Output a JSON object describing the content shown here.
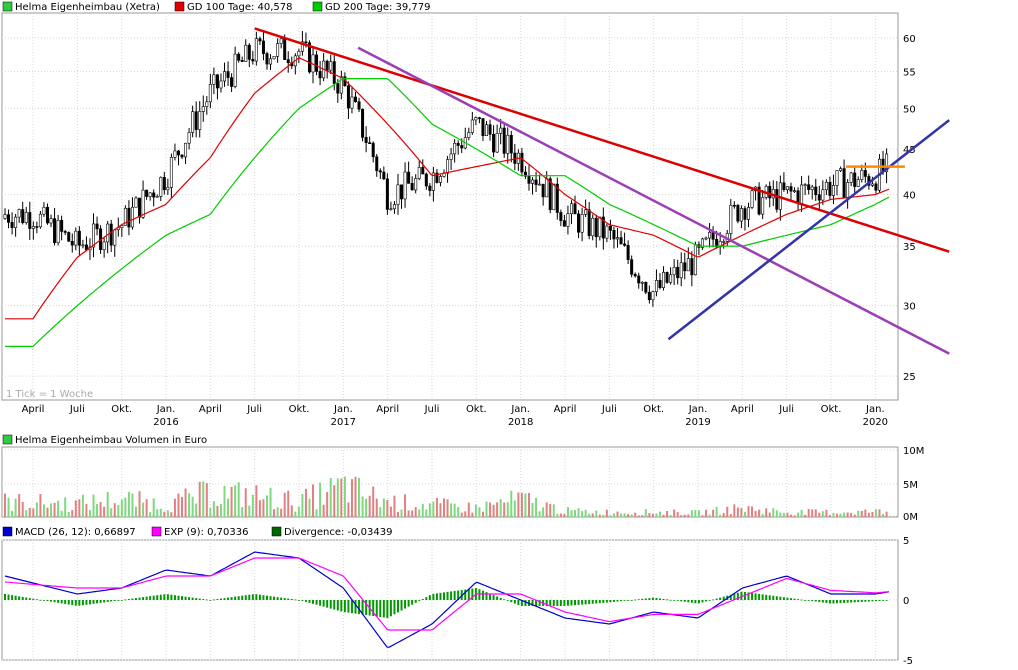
{
  "legend_main": {
    "stock": "Helma Eigenheimbau (Xetra)",
    "gd100": "GD 100 Tage: 40,578",
    "gd200": "GD 200 Tage: 39,779",
    "colors": {
      "stock": "#2ecc40",
      "gd100": "#e00000",
      "gd200": "#00cc00"
    }
  },
  "tick_note": "1 Tick = 1 Woche",
  "legend_volume": {
    "label": "Helma Eigenheimbau Volumen in Euro",
    "color": "#2ecc40"
  },
  "legend_macd": {
    "macd": "MACD (26, 12): 0,66897",
    "exp": "EXP (9): 0,70336",
    "divergence": "Divergence: -0,03439",
    "colors": {
      "macd": "#0000cc",
      "exp": "#ff00ff",
      "divergence": "#006600"
    }
  },
  "x_months": [
    "April",
    "Juli",
    "Okt.",
    "Jan.",
    "April",
    "Juli",
    "Okt.",
    "Jan.",
    "April",
    "Juli",
    "Okt.",
    "Jan.",
    "April",
    "Juli",
    "Okt.",
    "Jan.",
    "April",
    "Juli",
    "Okt.",
    "Jan."
  ],
  "x_years": [
    "2016",
    "2017",
    "2018",
    "2019",
    "2020"
  ],
  "y_price_ticks": [
    "60",
    "55",
    "50",
    "45",
    "40",
    "35",
    "30",
    "25"
  ],
  "y_volume_ticks": [
    "10M",
    "5M",
    "0M"
  ],
  "y_macd_ticks": [
    "5",
    "0",
    "-5"
  ],
  "chart_data": [
    {
      "type": "line",
      "title": "Helma Eigenheimbau (Xetra)",
      "scale": "log",
      "ylim": [
        23.5,
        64
      ],
      "x": [
        "2015-04",
        "2015-07",
        "2015-10",
        "2016-01",
        "2016-04",
        "2016-07",
        "2016-10",
        "2017-01",
        "2017-04",
        "2017-07",
        "2017-10",
        "2018-01",
        "2018-04",
        "2018-07",
        "2018-10",
        "2019-01",
        "2019-04",
        "2019-07",
        "2019-10",
        "2020-01",
        "2020-02"
      ],
      "series": [
        {
          "name": "Helma Eigenheimbau (Xetra)",
          "values": [
            38,
            35,
            37,
            42,
            52,
            58,
            58,
            53,
            40,
            42,
            48,
            44,
            38,
            36,
            31,
            34,
            39,
            40,
            41,
            42,
            43
          ]
        },
        {
          "name": "GD 100 Tage: 40,578",
          "values": [
            29,
            34,
            37,
            39,
            44,
            52,
            57,
            54,
            48,
            42,
            43,
            44,
            40,
            37,
            36,
            34,
            36,
            38,
            39.5,
            40,
            40.6
          ]
        },
        {
          "name": "GD 200 Tage: 39,779",
          "values": [
            27,
            30,
            33,
            36,
            38,
            44,
            50,
            54,
            54,
            48,
            45,
            42,
            42,
            39,
            37,
            35,
            35,
            36,
            37,
            39,
            39.8
          ]
        }
      ],
      "trendlines": [
        {
          "color": "#dd0000",
          "from": [
            "2016-07",
            61.5
          ],
          "to": [
            "2020-06",
            34.5
          ]
        },
        {
          "color": "#9b3fb5",
          "from": [
            "2017-02",
            58.5
          ],
          "to": [
            "2020-06",
            26.5
          ]
        },
        {
          "color": "#3333aa",
          "from": [
            "2018-11",
            27.5
          ],
          "to": [
            "2020-06",
            48.5
          ]
        },
        {
          "color": "#ff8800",
          "from": [
            "2019-11",
            43
          ],
          "to": [
            "2020-03",
            43
          ]
        }
      ]
    },
    {
      "type": "bar",
      "title": "Helma Eigenheimbau Volumen in Euro",
      "ylim": [
        0,
        10000000
      ],
      "x": [
        "2015-Q2",
        "2015-Q3",
        "2015-Q4",
        "2016-Q1",
        "2016-Q2",
        "2016-Q3",
        "2016-Q4",
        "2017-Q1",
        "2017-Q2",
        "2017-Q3",
        "2017-Q4",
        "2018-Q1",
        "2018-Q2",
        "2018-Q3",
        "2018-Q4",
        "2019-Q1",
        "2019-Q2",
        "2019-Q3",
        "2019-Q4",
        "2020-Q1"
      ],
      "values": [
        2500000,
        2200000,
        3000000,
        2000000,
        4000000,
        3500000,
        2500000,
        5000000,
        2500000,
        2000000,
        1500000,
        3000000,
        1000000,
        800000,
        800000,
        700000,
        1500000,
        800000,
        800000,
        900000
      ]
    },
    {
      "type": "line",
      "title": "MACD",
      "ylim": [
        -5,
        5
      ],
      "x": [
        "2015-04",
        "2015-07",
        "2015-10",
        "2016-01",
        "2016-04",
        "2016-07",
        "2016-10",
        "2017-01",
        "2017-04",
        "2017-07",
        "2017-10",
        "2018-01",
        "2018-04",
        "2018-07",
        "2018-10",
        "2019-01",
        "2019-04",
        "2019-07",
        "2019-10",
        "2020-01",
        "2020-02"
      ],
      "series": [
        {
          "name": "MACD (26, 12): 0,66897",
          "values": [
            2,
            0.5,
            1,
            2.5,
            2,
            4,
            3.5,
            1,
            -4,
            -2,
            1.5,
            0,
            -1.5,
            -2,
            -1,
            -1.5,
            1,
            2,
            0.5,
            0.5,
            0.7
          ]
        },
        {
          "name": "EXP (9): 0,70336",
          "values": [
            1.5,
            1,
            1,
            2,
            2,
            3.5,
            3.5,
            2,
            -2.5,
            -2.5,
            0.5,
            0.5,
            -1,
            -1.8,
            -1.2,
            -1.2,
            0.3,
            1.8,
            0.8,
            0.6,
            0.7
          ]
        },
        {
          "name": "Divergence: -0,03439",
          "values": [
            0.5,
            -0.5,
            0,
            0.5,
            0,
            0.5,
            0,
            -1,
            -1.5,
            0.5,
            1,
            -0.5,
            -0.5,
            -0.2,
            0.2,
            -0.3,
            0.7,
            0.2,
            -0.3,
            -0.1,
            -0.03
          ]
        }
      ]
    }
  ]
}
